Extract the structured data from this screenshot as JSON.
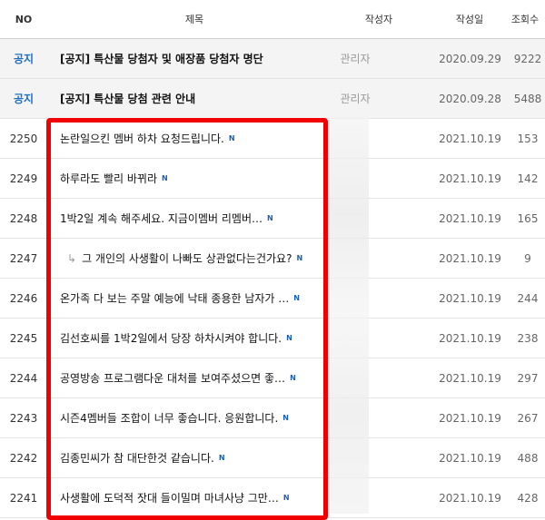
{
  "header": {
    "no": "NO",
    "title": "제목",
    "author": "작성자",
    "date": "작성일",
    "views": "조회수"
  },
  "notices": [
    {
      "no": "공지",
      "title": "[공지] 특산물 당첨자 및 애장품 당첨자 명단",
      "author": "관리자",
      "date": "2020.09.29",
      "views": "9222"
    },
    {
      "no": "공지",
      "title": "[공지] 특산물 당첨 관련 안내",
      "author": "관리자",
      "date": "2020.09.28",
      "views": "5488"
    }
  ],
  "posts": [
    {
      "no": "2250",
      "title": "논란일으킨 멤버 하차 요청드립니다.",
      "badge": "N",
      "date": "2021.10.19",
      "views": "153"
    },
    {
      "no": "2249",
      "title": "하루라도 빨리 바뀌라",
      "badge": "N",
      "date": "2021.10.19",
      "views": "142"
    },
    {
      "no": "2248",
      "title": "1박2일 계속 해주세요. 지금이멤버 리멤버…",
      "badge": "N",
      "date": "2021.10.19",
      "views": "165"
    },
    {
      "no": "2247",
      "reply_arrow": "↳",
      "title": "그 개인의 사생활이 나빠도 상관없다는건가요?",
      "badge": "N",
      "date": "2021.10.19",
      "views": "9"
    },
    {
      "no": "2246",
      "title": "온가족 다 보는 주말 예능에 낙태 종용한 남자가 …",
      "badge": "N",
      "date": "2021.10.19",
      "views": "244"
    },
    {
      "no": "2245",
      "title": "김선호씨를 1박2일에서 당장 하차시켜야 합니다.",
      "badge": "N",
      "date": "2021.10.19",
      "views": "238"
    },
    {
      "no": "2244",
      "title": "공영방송 프로그램다운 대처를 보여주셨으면 좋…",
      "badge": "N",
      "date": "2021.10.19",
      "views": "297"
    },
    {
      "no": "2243",
      "title": "시즌4멤버들 조합이 너무 좋습니다. 응원합니다.",
      "badge": "N",
      "date": "2021.10.19",
      "views": "267"
    },
    {
      "no": "2242",
      "title": "김종민씨가 참 대단한것 같습니다.",
      "badge": "N",
      "date": "2021.10.19",
      "views": "488"
    },
    {
      "no": "2241",
      "title": "사생활에 도덕적 잣대 들이밀며 마녀사냥 그만…",
      "badge": "N",
      "date": "2021.10.19",
      "views": "428"
    }
  ],
  "colors": {
    "highlight": "#f00000",
    "notice_no": "#1f6fc5",
    "new_badge": "#1a5fb4"
  }
}
